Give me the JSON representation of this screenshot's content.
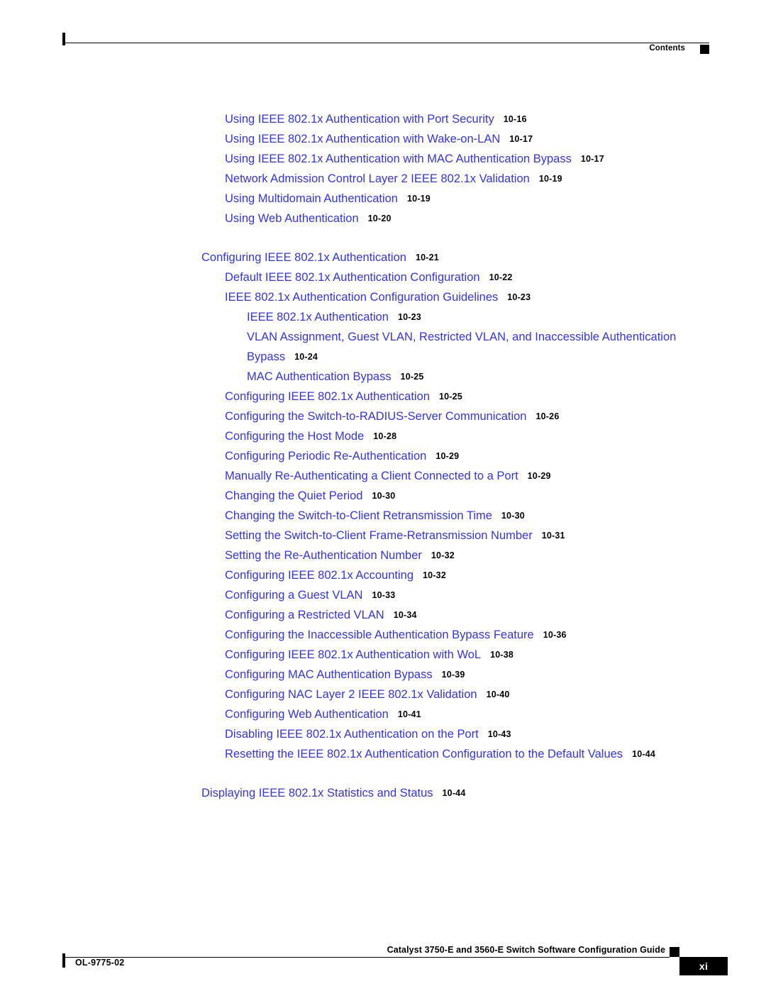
{
  "header": {
    "label": "Contents",
    "square_icon": "black-square-icon"
  },
  "footer": {
    "doc_id": "OL-9775-02",
    "title": "Catalyst 3750-E and 3560-E Switch Software Configuration Guide",
    "page_number": "xi",
    "square_icon": "black-square-icon"
  },
  "colors": {
    "link": "#3333f0",
    "page_number": "#000000",
    "rule": "#000000"
  },
  "toc": {
    "entries": [
      {
        "title": "Using IEEE 802.1x Authentication with Port Security",
        "page": "10-16",
        "level": 2
      },
      {
        "title": "Using IEEE 802.1x Authentication with Wake-on-LAN",
        "page": "10-17",
        "level": 2
      },
      {
        "title": "Using IEEE 802.1x Authentication with MAC Authentication Bypass",
        "page": "10-17",
        "level": 2
      },
      {
        "title": "Network Admission Control Layer 2 IEEE 802.1x Validation",
        "page": "10-19",
        "level": 2
      },
      {
        "title": "Using Multidomain Authentication",
        "page": "10-19",
        "level": 2
      },
      {
        "title": "Using Web Authentication",
        "page": "10-20",
        "level": 2
      },
      {
        "title": "Configuring IEEE 802.1x Authentication",
        "page": "10-21",
        "level": 1
      },
      {
        "title": "Default IEEE 802.1x Authentication Configuration",
        "page": "10-22",
        "level": 2
      },
      {
        "title": "IEEE 802.1x Authentication Configuration Guidelines",
        "page": "10-23",
        "level": 2
      },
      {
        "title": "IEEE 802.1x Authentication",
        "page": "10-23",
        "level": 3
      },
      {
        "title": "VLAN Assignment, Guest VLAN, Restricted VLAN, and Inaccessible Authentication Bypass",
        "page": "10-24",
        "level": 3
      },
      {
        "title": "MAC Authentication Bypass",
        "page": "10-25",
        "level": 3
      },
      {
        "title": "Configuring IEEE 802.1x Authentication",
        "page": "10-25",
        "level": 2
      },
      {
        "title": "Configuring the Switch-to-RADIUS-Server Communication",
        "page": "10-26",
        "level": 2
      },
      {
        "title": "Configuring the Host Mode",
        "page": "10-28",
        "level": 2
      },
      {
        "title": "Configuring Periodic Re-Authentication",
        "page": "10-29",
        "level": 2
      },
      {
        "title": "Manually Re-Authenticating a Client Connected to a Port",
        "page": "10-29",
        "level": 2
      },
      {
        "title": "Changing the Quiet Period",
        "page": "10-30",
        "level": 2
      },
      {
        "title": "Changing the Switch-to-Client Retransmission Time",
        "page": "10-30",
        "level": 2
      },
      {
        "title": "Setting the Switch-to-Client Frame-Retransmission Number",
        "page": "10-31",
        "level": 2
      },
      {
        "title": "Setting the Re-Authentication Number",
        "page": "10-32",
        "level": 2
      },
      {
        "title": "Configuring IEEE 802.1x Accounting",
        "page": "10-32",
        "level": 2
      },
      {
        "title": "Configuring a Guest VLAN",
        "page": "10-33",
        "level": 2
      },
      {
        "title": "Configuring a Restricted VLAN",
        "page": "10-34",
        "level": 2
      },
      {
        "title": "Configuring the Inaccessible Authentication Bypass Feature",
        "page": "10-36",
        "level": 2
      },
      {
        "title": "Configuring IEEE 802.1x Authentication with WoL",
        "page": "10-38",
        "level": 2
      },
      {
        "title": "Configuring MAC Authentication Bypass",
        "page": "10-39",
        "level": 2
      },
      {
        "title": "Configuring NAC Layer 2 IEEE 802.1x Validation",
        "page": "10-40",
        "level": 2
      },
      {
        "title": "Configuring Web Authentication",
        "page": "10-41",
        "level": 2
      },
      {
        "title": "Disabling IEEE 802.1x Authentication on the Port",
        "page": "10-43",
        "level": 2
      },
      {
        "title": "Resetting the IEEE 802.1x Authentication Configuration to the Default Values",
        "page": "10-44",
        "level": 2
      },
      {
        "title": "Displaying IEEE 802.1x Statistics and Status",
        "page": "10-44",
        "level": 1
      }
    ]
  }
}
